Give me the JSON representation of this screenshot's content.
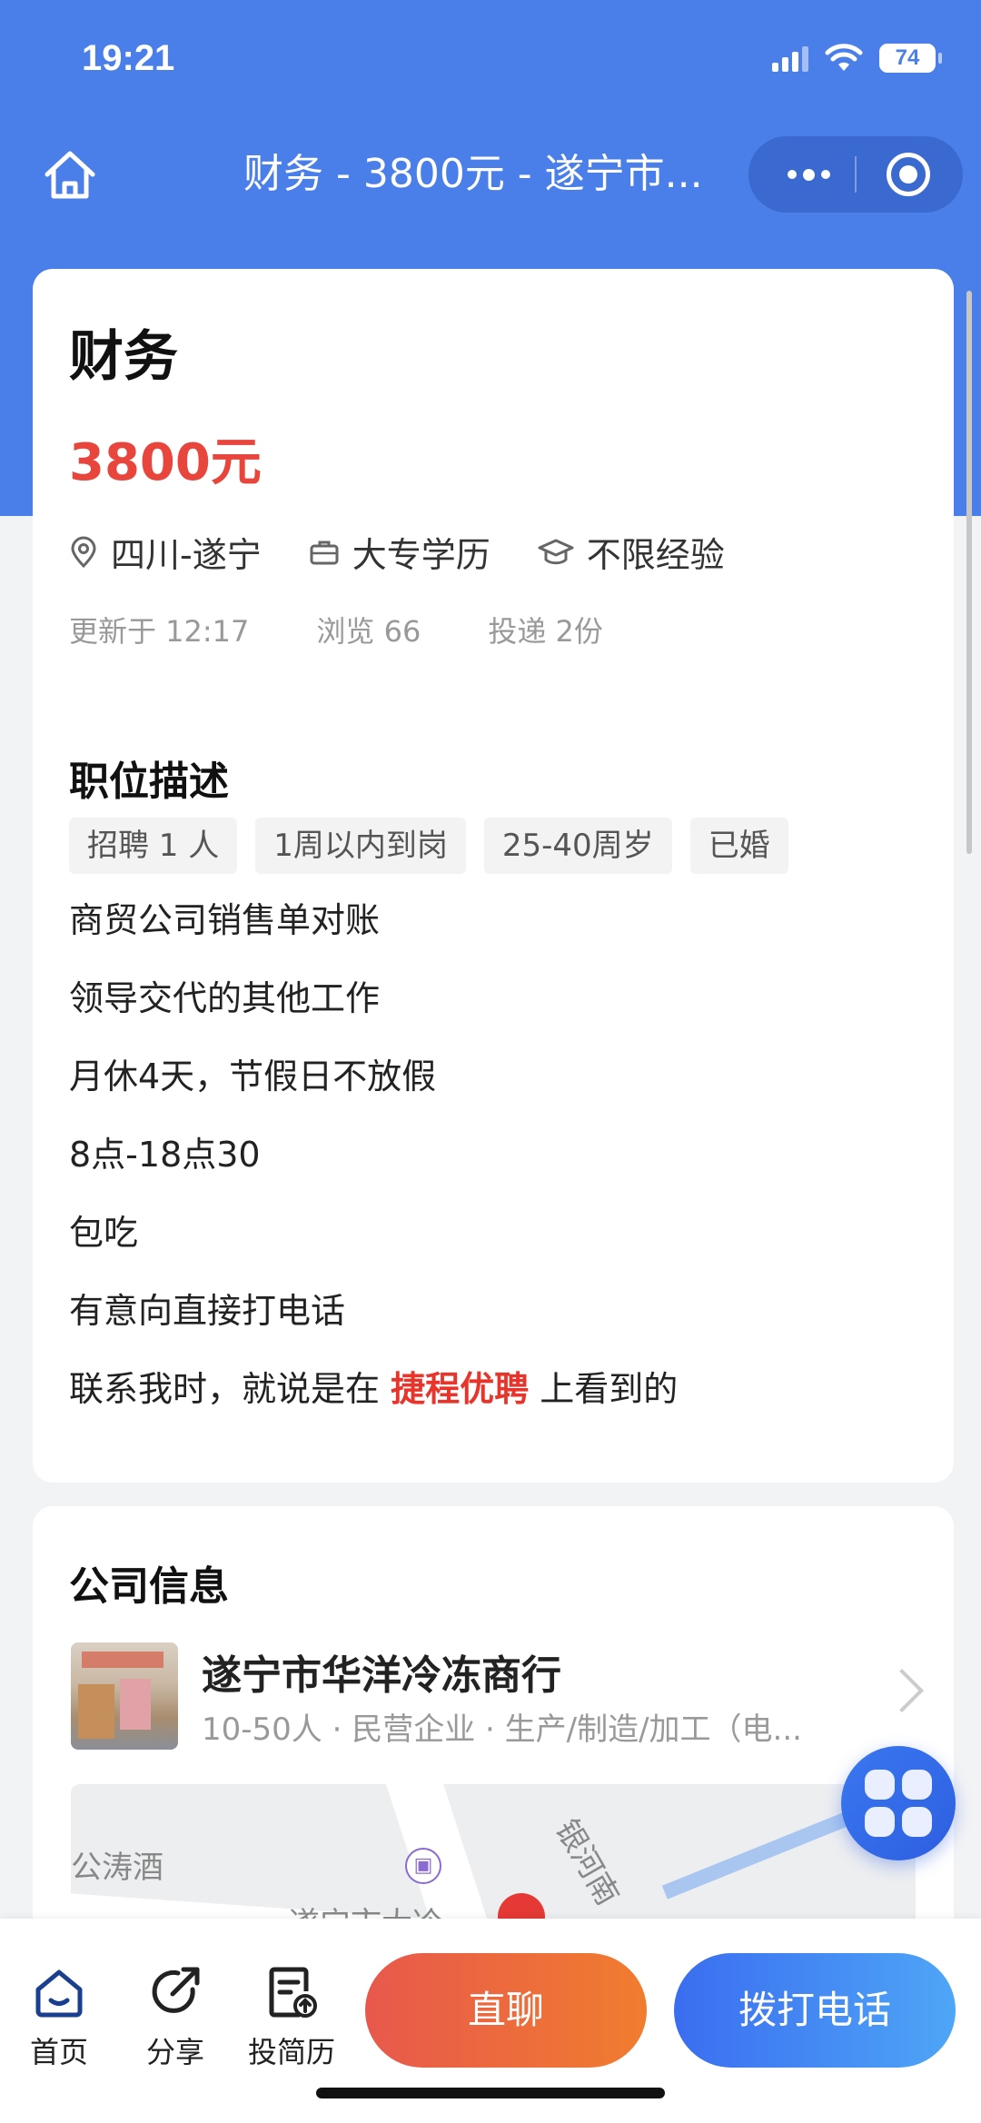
{
  "status_bar": {
    "time": "19:21",
    "battery": "74"
  },
  "nav": {
    "title": "财务 - 3800元 - 遂宁市..."
  },
  "job": {
    "title": "财务",
    "salary": "3800元",
    "location": "四川-遂宁",
    "education": "大专学历",
    "experience": "不限经验",
    "updated": "更新于 12:17",
    "views": "浏览 66",
    "applications": "投递 2份"
  },
  "description": {
    "section_title": "职位描述",
    "tags": [
      "招聘 1 人",
      "1周以内到岗",
      "25-40周岁",
      "已婚"
    ],
    "lines": [
      "商贸公司销售单对账",
      "领导交代的其他工作",
      "月休4天，节假日不放假",
      "8点-18点30",
      "包吃",
      "有意向直接打电话"
    ],
    "contact_prefix": "联系我时，就说是在 ",
    "contact_highlight": "捷程优聘",
    "contact_suffix": " 上看到的"
  },
  "company": {
    "section_title": "公司信息",
    "name": "遂宁市华洋冷冻商行",
    "info": "10-50人 · 民营企业 · 生产/制造/加工（电...",
    "map_labels": [
      "公涛酒",
      "银河南",
      "遂宁市大冷"
    ]
  },
  "bottom_bar": {
    "home": "首页",
    "share": "分享",
    "resume": "投简历",
    "chat": "直聊",
    "call": "拨打电话"
  },
  "colors": {
    "brand_blue": "#4a7ee8",
    "salary_red": "#e8453c",
    "chat_orange": "#f07d2e",
    "call_blue": "#3a6df0"
  }
}
